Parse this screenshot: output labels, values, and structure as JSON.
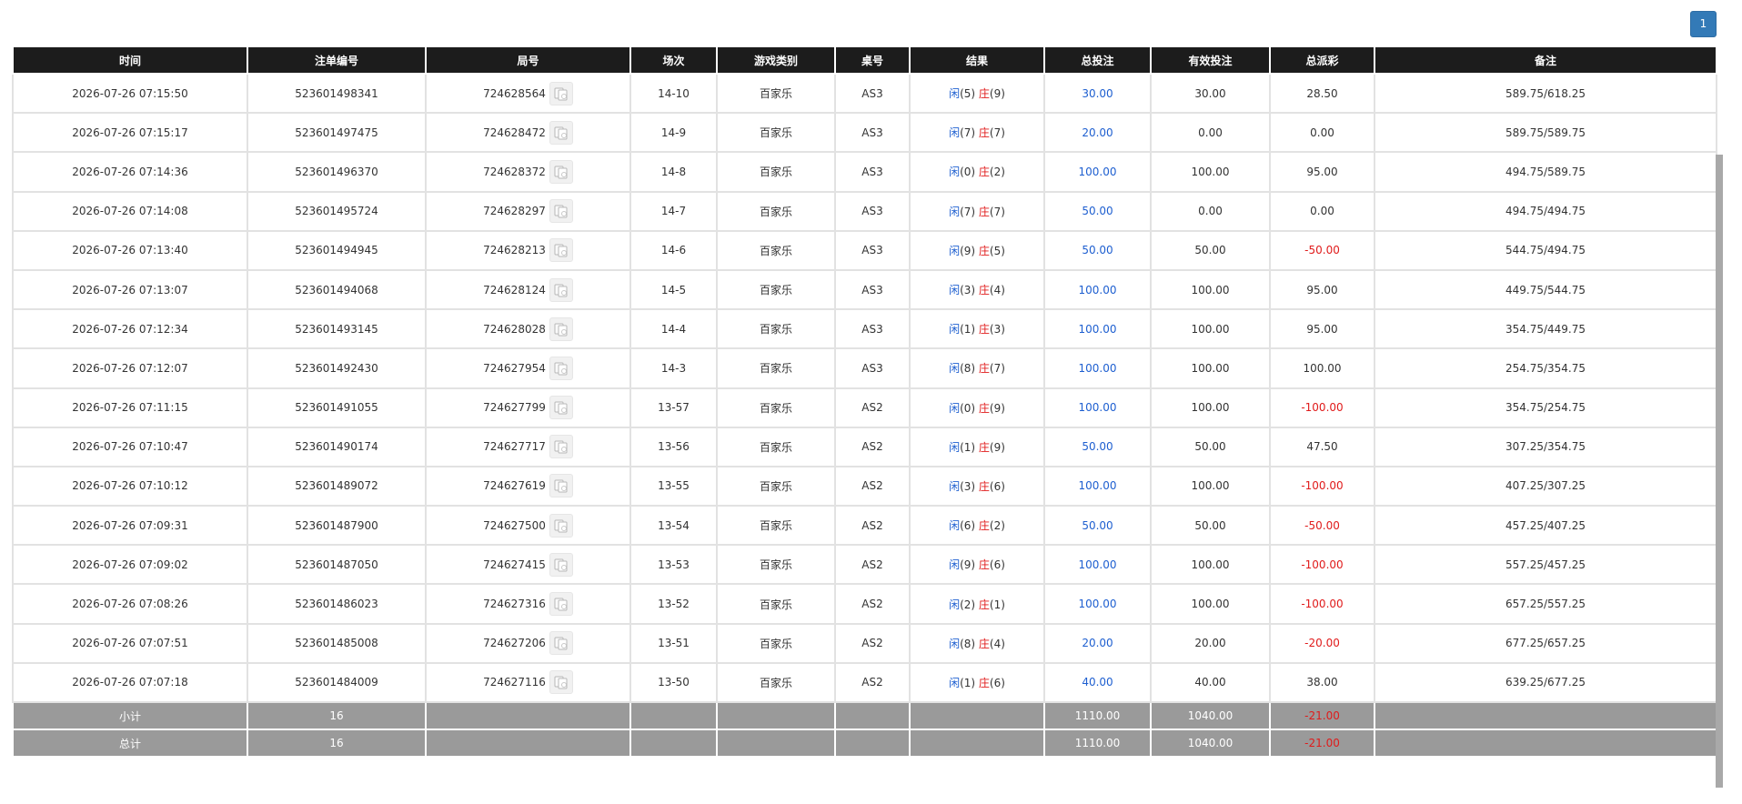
{
  "pagination": {
    "current": "1"
  },
  "columns": [
    "时间",
    "注单编号",
    "局号",
    "场次",
    "游戏类别",
    "桌号",
    "结果",
    "总投注",
    "有效投注",
    "总派彩",
    "备注"
  ],
  "player_label": "闲",
  "banker_label": "庄",
  "icons": {
    "replay": "card-replay-icon"
  },
  "colors": {
    "bet_blue": "#1e5fd0",
    "loss_red": "#e01b1b",
    "header_bg": "#1c1c1c",
    "footer_bg": "#9a9a9a",
    "pager_bg": "#337ab7"
  },
  "rows": [
    {
      "time": "2026-07-26 07:15:50",
      "bet_id": "523601498341",
      "round": "724628564",
      "session": "14-10",
      "game": "百家乐",
      "table": "AS3",
      "player": "(5)",
      "banker": "(9)",
      "total_bet": "30.00",
      "valid_bet": "30.00",
      "payout": "28.50",
      "payout_negative": false,
      "note": "589.75/618.25"
    },
    {
      "time": "2026-07-26 07:15:17",
      "bet_id": "523601497475",
      "round": "724628472",
      "session": "14-9",
      "game": "百家乐",
      "table": "AS3",
      "player": "(7)",
      "banker": "(7)",
      "total_bet": "20.00",
      "valid_bet": "0.00",
      "payout": "0.00",
      "payout_negative": false,
      "note": "589.75/589.75"
    },
    {
      "time": "2026-07-26 07:14:36",
      "bet_id": "523601496370",
      "round": "724628372",
      "session": "14-8",
      "game": "百家乐",
      "table": "AS3",
      "player": "(0)",
      "banker": "(2)",
      "total_bet": "100.00",
      "valid_bet": "100.00",
      "payout": "95.00",
      "payout_negative": false,
      "note": "494.75/589.75"
    },
    {
      "time": "2026-07-26 07:14:08",
      "bet_id": "523601495724",
      "round": "724628297",
      "session": "14-7",
      "game": "百家乐",
      "table": "AS3",
      "player": "(7)",
      "banker": "(7)",
      "total_bet": "50.00",
      "valid_bet": "0.00",
      "payout": "0.00",
      "payout_negative": false,
      "note": "494.75/494.75"
    },
    {
      "time": "2026-07-26 07:13:40",
      "bet_id": "523601494945",
      "round": "724628213",
      "session": "14-6",
      "game": "百家乐",
      "table": "AS3",
      "player": "(9)",
      "banker": "(5)",
      "total_bet": "50.00",
      "valid_bet": "50.00",
      "payout": "-50.00",
      "payout_negative": true,
      "note": "544.75/494.75"
    },
    {
      "time": "2026-07-26 07:13:07",
      "bet_id": "523601494068",
      "round": "724628124",
      "session": "14-5",
      "game": "百家乐",
      "table": "AS3",
      "player": "(3)",
      "banker": "(4)",
      "total_bet": "100.00",
      "valid_bet": "100.00",
      "payout": "95.00",
      "payout_negative": false,
      "note": "449.75/544.75"
    },
    {
      "time": "2026-07-26 07:12:34",
      "bet_id": "523601493145",
      "round": "724628028",
      "session": "14-4",
      "game": "百家乐",
      "table": "AS3",
      "player": "(1)",
      "banker": "(3)",
      "total_bet": "100.00",
      "valid_bet": "100.00",
      "payout": "95.00",
      "payout_negative": false,
      "note": "354.75/449.75"
    },
    {
      "time": "2026-07-26 07:12:07",
      "bet_id": "523601492430",
      "round": "724627954",
      "session": "14-3",
      "game": "百家乐",
      "table": "AS3",
      "player": "(8)",
      "banker": "(7)",
      "total_bet": "100.00",
      "valid_bet": "100.00",
      "payout": "100.00",
      "payout_negative": false,
      "note": "254.75/354.75"
    },
    {
      "time": "2026-07-26 07:11:15",
      "bet_id": "523601491055",
      "round": "724627799",
      "session": "13-57",
      "game": "百家乐",
      "table": "AS2",
      "player": "(0)",
      "banker": "(9)",
      "total_bet": "100.00",
      "valid_bet": "100.00",
      "payout": "-100.00",
      "payout_negative": true,
      "note": "354.75/254.75"
    },
    {
      "time": "2026-07-26 07:10:47",
      "bet_id": "523601490174",
      "round": "724627717",
      "session": "13-56",
      "game": "百家乐",
      "table": "AS2",
      "player": "(1)",
      "banker": "(9)",
      "total_bet": "50.00",
      "valid_bet": "50.00",
      "payout": "47.50",
      "payout_negative": false,
      "note": "307.25/354.75"
    },
    {
      "time": "2026-07-26 07:10:12",
      "bet_id": "523601489072",
      "round": "724627619",
      "session": "13-55",
      "game": "百家乐",
      "table": "AS2",
      "player": "(3)",
      "banker": "(6)",
      "total_bet": "100.00",
      "valid_bet": "100.00",
      "payout": "-100.00",
      "payout_negative": true,
      "note": "407.25/307.25"
    },
    {
      "time": "2026-07-26 07:09:31",
      "bet_id": "523601487900",
      "round": "724627500",
      "session": "13-54",
      "game": "百家乐",
      "table": "AS2",
      "player": "(6)",
      "banker": "(2)",
      "total_bet": "50.00",
      "valid_bet": "50.00",
      "payout": "-50.00",
      "payout_negative": true,
      "note": "457.25/407.25"
    },
    {
      "time": "2026-07-26 07:09:02",
      "bet_id": "523601487050",
      "round": "724627415",
      "session": "13-53",
      "game": "百家乐",
      "table": "AS2",
      "player": "(9)",
      "banker": "(6)",
      "total_bet": "100.00",
      "valid_bet": "100.00",
      "payout": "-100.00",
      "payout_negative": true,
      "note": "557.25/457.25"
    },
    {
      "time": "2026-07-26 07:08:26",
      "bet_id": "523601486023",
      "round": "724627316",
      "session": "13-52",
      "game": "百家乐",
      "table": "AS2",
      "player": "(2)",
      "banker": "(1)",
      "total_bet": "100.00",
      "valid_bet": "100.00",
      "payout": "-100.00",
      "payout_negative": true,
      "note": "657.25/557.25"
    },
    {
      "time": "2026-07-26 07:07:51",
      "bet_id": "523601485008",
      "round": "724627206",
      "session": "13-51",
      "game": "百家乐",
      "table": "AS2",
      "player": "(8)",
      "banker": "(4)",
      "total_bet": "20.00",
      "valid_bet": "20.00",
      "payout": "-20.00",
      "payout_negative": true,
      "note": "677.25/657.25"
    },
    {
      "time": "2026-07-26 07:07:18",
      "bet_id": "523601484009",
      "round": "724627116",
      "session": "13-50",
      "game": "百家乐",
      "table": "AS2",
      "player": "(1)",
      "banker": "(6)",
      "total_bet": "40.00",
      "valid_bet": "40.00",
      "payout": "38.00",
      "payout_negative": false,
      "note": "639.25/677.25"
    }
  ],
  "footer": [
    {
      "label": "小计",
      "count": "16",
      "total_bet": "1110.00",
      "valid_bet": "1040.00",
      "payout": "-21.00"
    },
    {
      "label": "总计",
      "count": "16",
      "total_bet": "1110.00",
      "valid_bet": "1040.00",
      "payout": "-21.00"
    }
  ]
}
